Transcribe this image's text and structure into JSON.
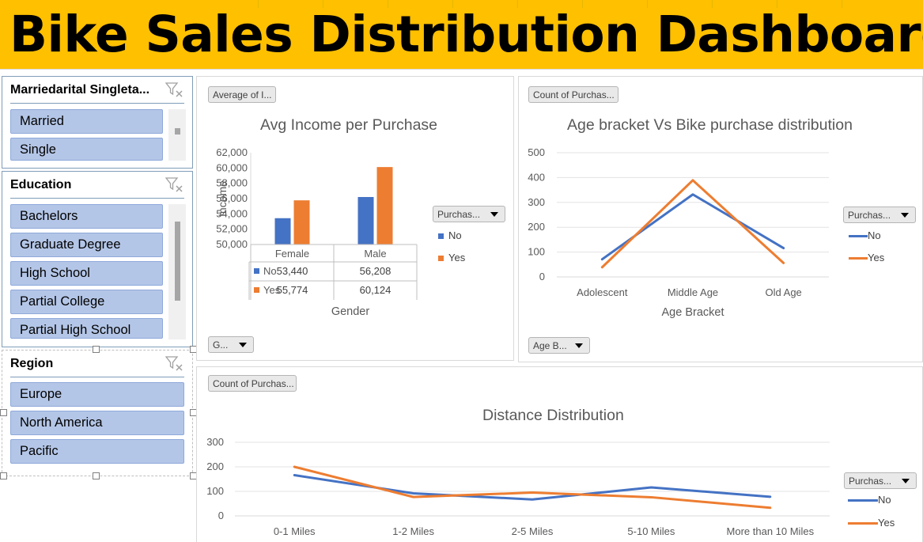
{
  "dashboard": {
    "title": "Bike Sales Distribution Dashboard"
  },
  "slicers": {
    "marital": {
      "header": "Marriedarital Singleta...",
      "items": [
        "Married",
        "Single"
      ]
    },
    "education": {
      "header": "Education",
      "items": [
        "Bachelors",
        "Graduate Degree",
        "High School",
        "Partial College",
        "Partial High School"
      ]
    },
    "region": {
      "header": "Region",
      "items": [
        "Europe",
        "North America",
        "Pacific"
      ]
    }
  },
  "colors": {
    "no": "#4472c4",
    "yes": "#ed7d31",
    "banner": "#ffc000",
    "slicer_item": "#b4c6e7"
  },
  "chart_data": [
    {
      "type": "bar",
      "title": "Avg Income per Purchase",
      "value_button": "Average of I...",
      "axis_button": "G...",
      "legend_button": "Purchas...",
      "xlabel": "Gender",
      "ylabel": "Income",
      "categories": [
        "Female",
        "Male"
      ],
      "series": [
        {
          "name": "No",
          "values": [
            53440,
            56208
          ],
          "labels": [
            "53,440",
            "56,208"
          ]
        },
        {
          "name": "Yes",
          "values": [
            55774,
            60124
          ],
          "labels": [
            "55,774",
            "60,124"
          ]
        }
      ],
      "ylim": [
        50000,
        62000
      ],
      "yticks": [
        "50,000",
        "52,000",
        "54,000",
        "56,000",
        "58,000",
        "60,000",
        "62,000"
      ],
      "data_table": true,
      "grid": false,
      "legend_position": "right"
    },
    {
      "type": "line",
      "title": "Age bracket Vs Bike purchase distribution",
      "value_button": "Count of Purchas...",
      "axis_button": "Age B...",
      "legend_button": "Purchas...",
      "xlabel": "Age Bracket",
      "ylabel": "",
      "categories": [
        "Adolescent",
        "Middle Age",
        "Old Age"
      ],
      "series": [
        {
          "name": "No",
          "values": [
            71,
            332,
            116
          ]
        },
        {
          "name": "Yes",
          "values": [
            39,
            389,
            56
          ]
        }
      ],
      "ylim": [
        0,
        500
      ],
      "yticks": [
        "0",
        "100",
        "200",
        "300",
        "400",
        "500"
      ],
      "grid": true,
      "legend_position": "right"
    },
    {
      "type": "line",
      "title": "Distance Distribution",
      "value_button": "Count of Purchas...",
      "legend_button": "Purchas...",
      "xlabel": "",
      "ylabel": "",
      "categories": [
        "0-1 Miles",
        "1-2 Miles",
        "2-5 Miles",
        "5-10 Miles",
        "More than 10 Miles"
      ],
      "series": [
        {
          "name": "No",
          "values": [
            166,
            92,
            67,
            116,
            78
          ]
        },
        {
          "name": "Yes",
          "values": [
            200,
            77,
            95,
            76,
            33
          ]
        }
      ],
      "ylim": [
        0,
        300
      ],
      "yticks": [
        "0",
        "100",
        "200",
        "300"
      ],
      "grid": true,
      "legend_position": "right"
    }
  ]
}
